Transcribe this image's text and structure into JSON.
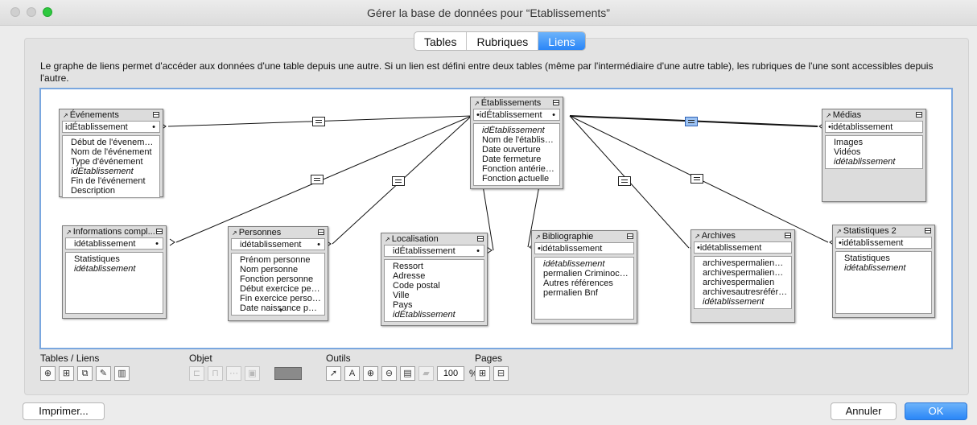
{
  "window": {
    "title": "Gérer la base de données pour “Etablissements”"
  },
  "tabs": [
    {
      "label": "Tables",
      "active": false
    },
    {
      "label": "Rubriques",
      "active": false
    },
    {
      "label": "Liens",
      "active": true
    }
  ],
  "description": "Le graphe de liens permet d'accéder aux données d'une table depuis une autre. Si un lien est défini entre deux tables (même par l'intermédiaire d'une autre table), les rubriques de l'une sont accessibles depuis l'autre.",
  "tables": [
    {
      "name": "Événements",
      "key": "idÉtablissement",
      "fields": [
        "Début de l'évenement",
        "Nom de l'événement",
        "Type d'événement",
        "idÉtablissement",
        "Fin de l'événement",
        "Description"
      ],
      "italic": [
        "idÉtablissement"
      ]
    },
    {
      "name": "Établissements",
      "key": "idÉtablissement",
      "fields": [
        "idÉtablissement",
        "Nom de l'établisse...",
        "Date ouverture",
        "Date fermeture",
        "Fonction antérieure",
        "Fonction actuelle"
      ],
      "italic": [
        "idÉtablissement"
      ]
    },
    {
      "name": "Médias",
      "key": "idétablissement",
      "fields": [
        "Images",
        "Vidéos",
        "idétablissement"
      ],
      "italic": [
        "idétablissement"
      ]
    },
    {
      "name": "Informations compl...",
      "key": "idétablissement",
      "fields": [
        "Statistiques",
        "idétablissement"
      ],
      "italic": [
        "idétablissement"
      ]
    },
    {
      "name": "Personnes",
      "key": "idétablissement",
      "fields": [
        "Prénom personne",
        "Nom personne",
        "Fonction personne",
        "Début exercice pers...",
        "Fin exercice personne",
        "Date naissance pers..."
      ],
      "italic": []
    },
    {
      "name": "Localisation",
      "key": "idÉtablissement",
      "fields": [
        "Ressort",
        "Adresse",
        "Code postal",
        "Ville",
        "Pays",
        "idÉtablissement"
      ],
      "italic": [
        "idÉtablissement"
      ]
    },
    {
      "name": "Bibliographie",
      "key": "idétablissement",
      "fields": [
        "idétablissement",
        "permalien Criminocor...",
        "Autres références",
        "permalien Bnf"
      ],
      "italic": [
        "idétablissement"
      ]
    },
    {
      "name": "Archives",
      "key": "idétablissement",
      "fields": [
        "archivespermalienCri...",
        "archivespermalienGal...",
        "archivespermalien",
        "archivesautresréféren...",
        "idétablissement"
      ],
      "italic": [
        "idétablissement"
      ]
    },
    {
      "name": "Statistiques 2",
      "key": "idétablissement",
      "fields": [
        "Statistiques",
        "idétablissement"
      ],
      "italic": [
        "idétablissement"
      ]
    }
  ],
  "toolbar": {
    "tables_liens_label": "Tables / Liens",
    "objet_label": "Objet",
    "outils_label": "Outils",
    "pages_label": "Pages",
    "zoom_value": "100",
    "zoom_unit": "%"
  },
  "buttons": {
    "print": "Imprimer...",
    "cancel": "Annuler",
    "ok": "OK"
  },
  "colors": {
    "accent": "#2a86f7",
    "selected_link": "#9cc2f2"
  }
}
